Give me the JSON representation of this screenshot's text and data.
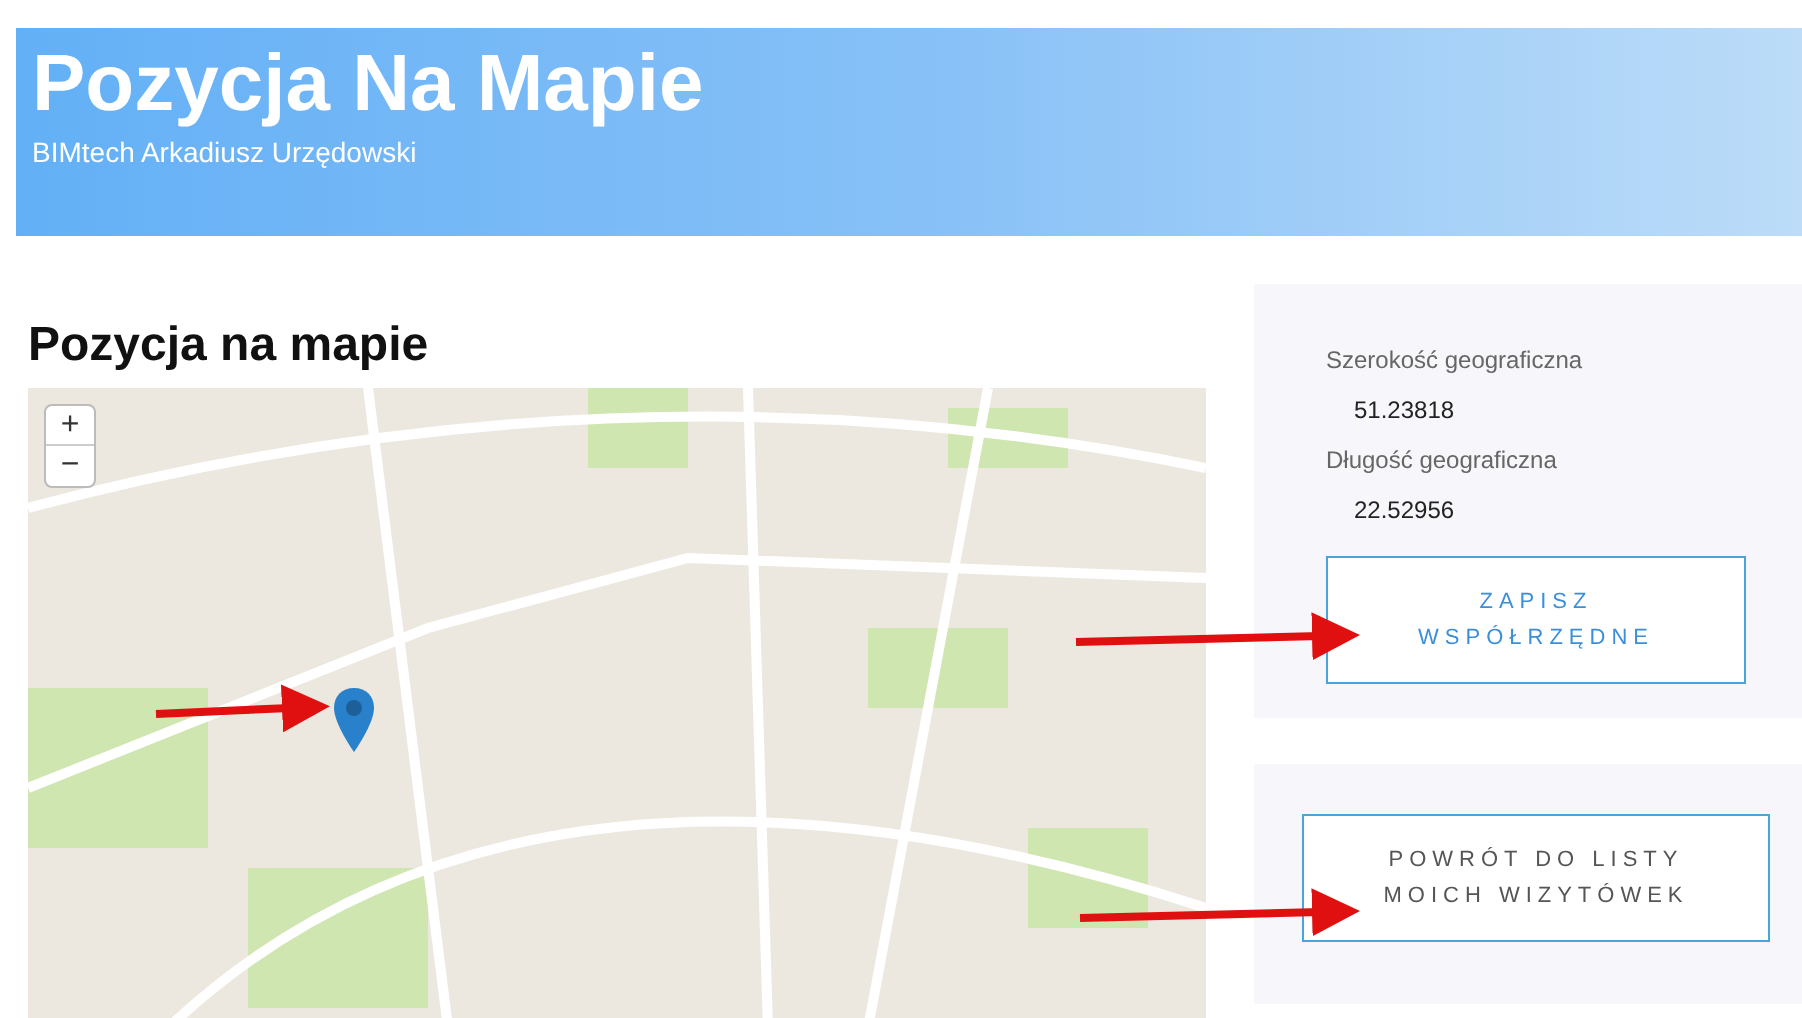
{
  "banner": {
    "title": "Pozycja Na Mapie",
    "subtitle": "BIMtech Arkadiusz Urzędowski"
  },
  "heading": "Pozycja na mapie",
  "map": {
    "zoom_in": "+",
    "zoom_out": "−"
  },
  "coordinates": [
    {
      "label": "Szerokość geograficzna",
      "value": "51.23818"
    },
    {
      "label": "Długość geograficzna",
      "value": "22.52956"
    }
  ],
  "save_button": "ZAPISZ WSPÓŁRZĘDNE",
  "back_button": "POWRÓT DO LISTY MOICH WIZYTÓWEK"
}
